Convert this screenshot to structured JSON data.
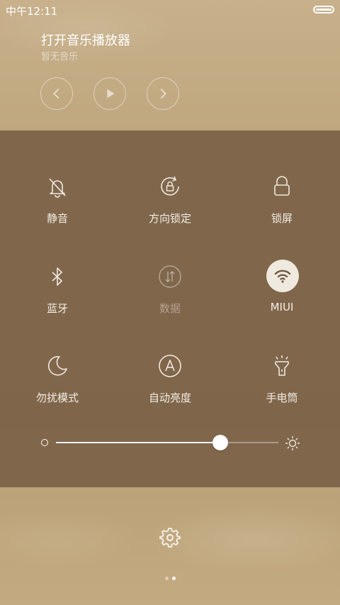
{
  "status_bar": {
    "time": "中午12:11",
    "battery_icon": "battery-icon"
  },
  "music": {
    "title": "打开音乐播放器",
    "subtitle": "暂无音乐",
    "controls": [
      "previous-icon",
      "play-icon",
      "next-icon"
    ]
  },
  "quick_settings": {
    "tiles": [
      {
        "label": "静音",
        "icon": "bell-off-icon",
        "active": false
      },
      {
        "label": "方向锁定",
        "icon": "rotation-lock-icon",
        "active": false
      },
      {
        "label": "锁屏",
        "icon": "lock-icon",
        "active": false
      },
      {
        "label": "蓝牙",
        "icon": "bluetooth-icon",
        "active": false
      },
      {
        "label": "数据",
        "icon": "mobile-data-icon",
        "active": false,
        "disabled": true
      },
      {
        "label": "MIUI",
        "icon": "wifi-icon",
        "active": true
      },
      {
        "label": "勿扰模式",
        "icon": "moon-icon",
        "active": false
      },
      {
        "label": "自动亮度",
        "icon": "auto-brightness-icon",
        "active": false
      },
      {
        "label": "手电筒",
        "icon": "flashlight-icon",
        "active": false
      }
    ],
    "brightness_level": 0.74
  },
  "colors": {
    "panel": "#7f6650",
    "accent": "#ffffff"
  },
  "page_indicator": {
    "pages": 2,
    "current": 2
  }
}
